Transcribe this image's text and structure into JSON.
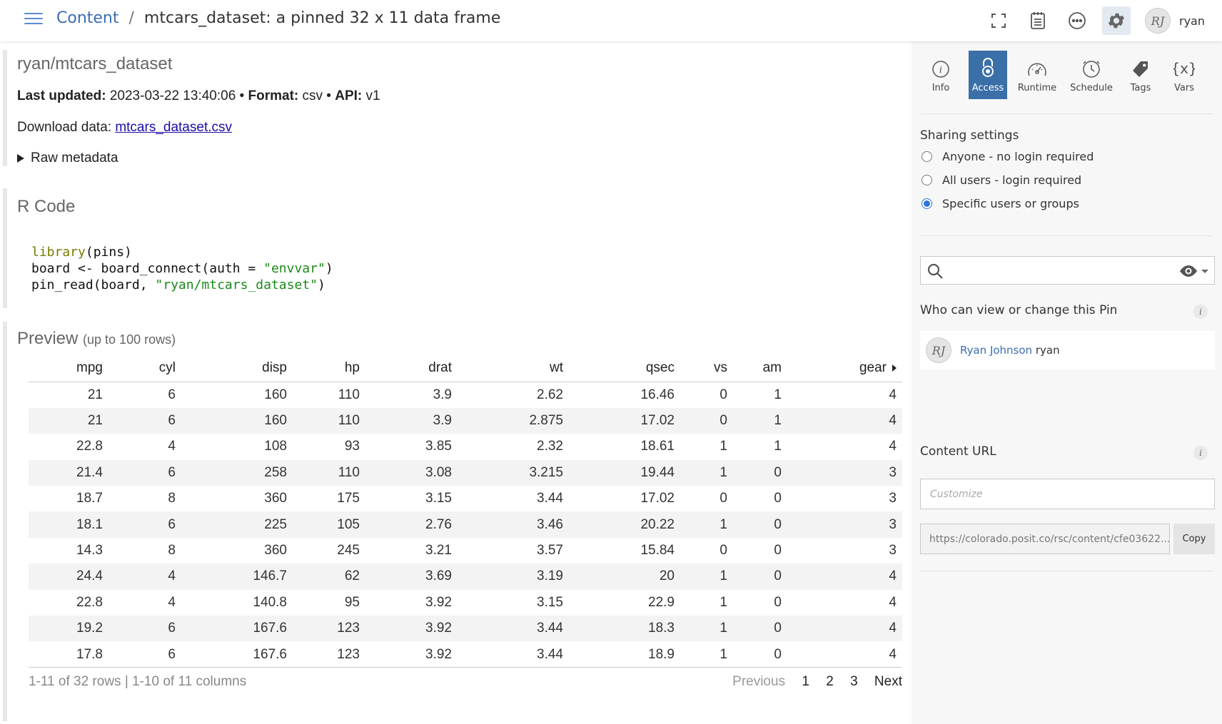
{
  "header": {
    "breadcrumb_root": "Content",
    "breadcrumb_sep": "/",
    "title": "mtcars_dataset: a pinned 32 x 11 data frame",
    "user_initials": "RJ",
    "user_name": "ryan"
  },
  "pin": {
    "name": "ryan/mtcars_dataset",
    "last_updated_label": "Last updated:",
    "last_updated": "2023-03-22 13:40:06",
    "format_label": "Format:",
    "format": "csv",
    "api_label": "API:",
    "api": "v1",
    "download_label": "Download data:",
    "download_link": "mtcars_dataset.csv",
    "raw_metadata": "Raw metadata"
  },
  "rcode": {
    "title": "R Code",
    "line1_fn": "library",
    "line1_rest": "(pins)",
    "line2": "board <- board_connect(auth = ",
    "line2_str": "\"envvar\"",
    "line2_end": ")",
    "line3": "pin_read(board, ",
    "line3_str": "\"ryan/mtcars_dataset\"",
    "line3_end": ")"
  },
  "preview": {
    "title": "Preview",
    "subtitle": "(up to 100 rows)",
    "columns": [
      "mpg",
      "cyl",
      "disp",
      "hp",
      "drat",
      "wt",
      "qsec",
      "vs",
      "am",
      "gear"
    ],
    "rows": [
      [
        "21",
        "6",
        "160",
        "110",
        "3.9",
        "2.62",
        "16.46",
        "0",
        "1",
        "4"
      ],
      [
        "21",
        "6",
        "160",
        "110",
        "3.9",
        "2.875",
        "17.02",
        "0",
        "1",
        "4"
      ],
      [
        "22.8",
        "4",
        "108",
        "93",
        "3.85",
        "2.32",
        "18.61",
        "1",
        "1",
        "4"
      ],
      [
        "21.4",
        "6",
        "258",
        "110",
        "3.08",
        "3.215",
        "19.44",
        "1",
        "0",
        "3"
      ],
      [
        "18.7",
        "8",
        "360",
        "175",
        "3.15",
        "3.44",
        "17.02",
        "0",
        "0",
        "3"
      ],
      [
        "18.1",
        "6",
        "225",
        "105",
        "2.76",
        "3.46",
        "20.22",
        "1",
        "0",
        "3"
      ],
      [
        "14.3",
        "8",
        "360",
        "245",
        "3.21",
        "3.57",
        "15.84",
        "0",
        "0",
        "3"
      ],
      [
        "24.4",
        "4",
        "146.7",
        "62",
        "3.69",
        "3.19",
        "20",
        "1",
        "0",
        "4"
      ],
      [
        "22.8",
        "4",
        "140.8",
        "95",
        "3.92",
        "3.15",
        "22.9",
        "1",
        "0",
        "4"
      ],
      [
        "19.2",
        "6",
        "167.6",
        "123",
        "3.92",
        "3.44",
        "18.3",
        "1",
        "0",
        "4"
      ],
      [
        "17.8",
        "6",
        "167.6",
        "123",
        "3.92",
        "3.44",
        "18.9",
        "1",
        "0",
        "4"
      ]
    ],
    "rows_info": "1-11 of 32 rows | 1-10 of 11 columns",
    "pager": {
      "previous": "Previous",
      "p1": "1",
      "p2": "2",
      "p3": "3",
      "next": "Next"
    }
  },
  "panel": {
    "tabs": [
      {
        "label": "Info",
        "icon": "info-icon"
      },
      {
        "label": "Access",
        "icon": "lock-icon"
      },
      {
        "label": "Runtime",
        "icon": "speedometer-icon"
      },
      {
        "label": "Schedule",
        "icon": "clock-icon"
      },
      {
        "label": "Tags",
        "icon": "tag-icon"
      },
      {
        "label": "Vars",
        "icon": "variable-icon"
      }
    ],
    "active_tab": "Access",
    "sharing_title": "Sharing settings",
    "sharing_options": [
      "Anyone - no login required",
      "All users - login required",
      "Specific users or groups"
    ],
    "sharing_selected": "Specific users or groups",
    "who_title": "Who can view or change this Pin",
    "info_glyph": "i",
    "owner_initials": "RJ",
    "owner_name": "Ryan Johnson",
    "owner_username": "ryan",
    "content_url_title": "Content URL",
    "customize_placeholder": "Customize",
    "url": "https://colorado.posit.co/rsc/content/cfe03622...",
    "copy_label": "Copy"
  },
  "colors": {
    "accent": "#3a6fa8",
    "link": "#3b6db3",
    "radio": "#2f73d9"
  }
}
